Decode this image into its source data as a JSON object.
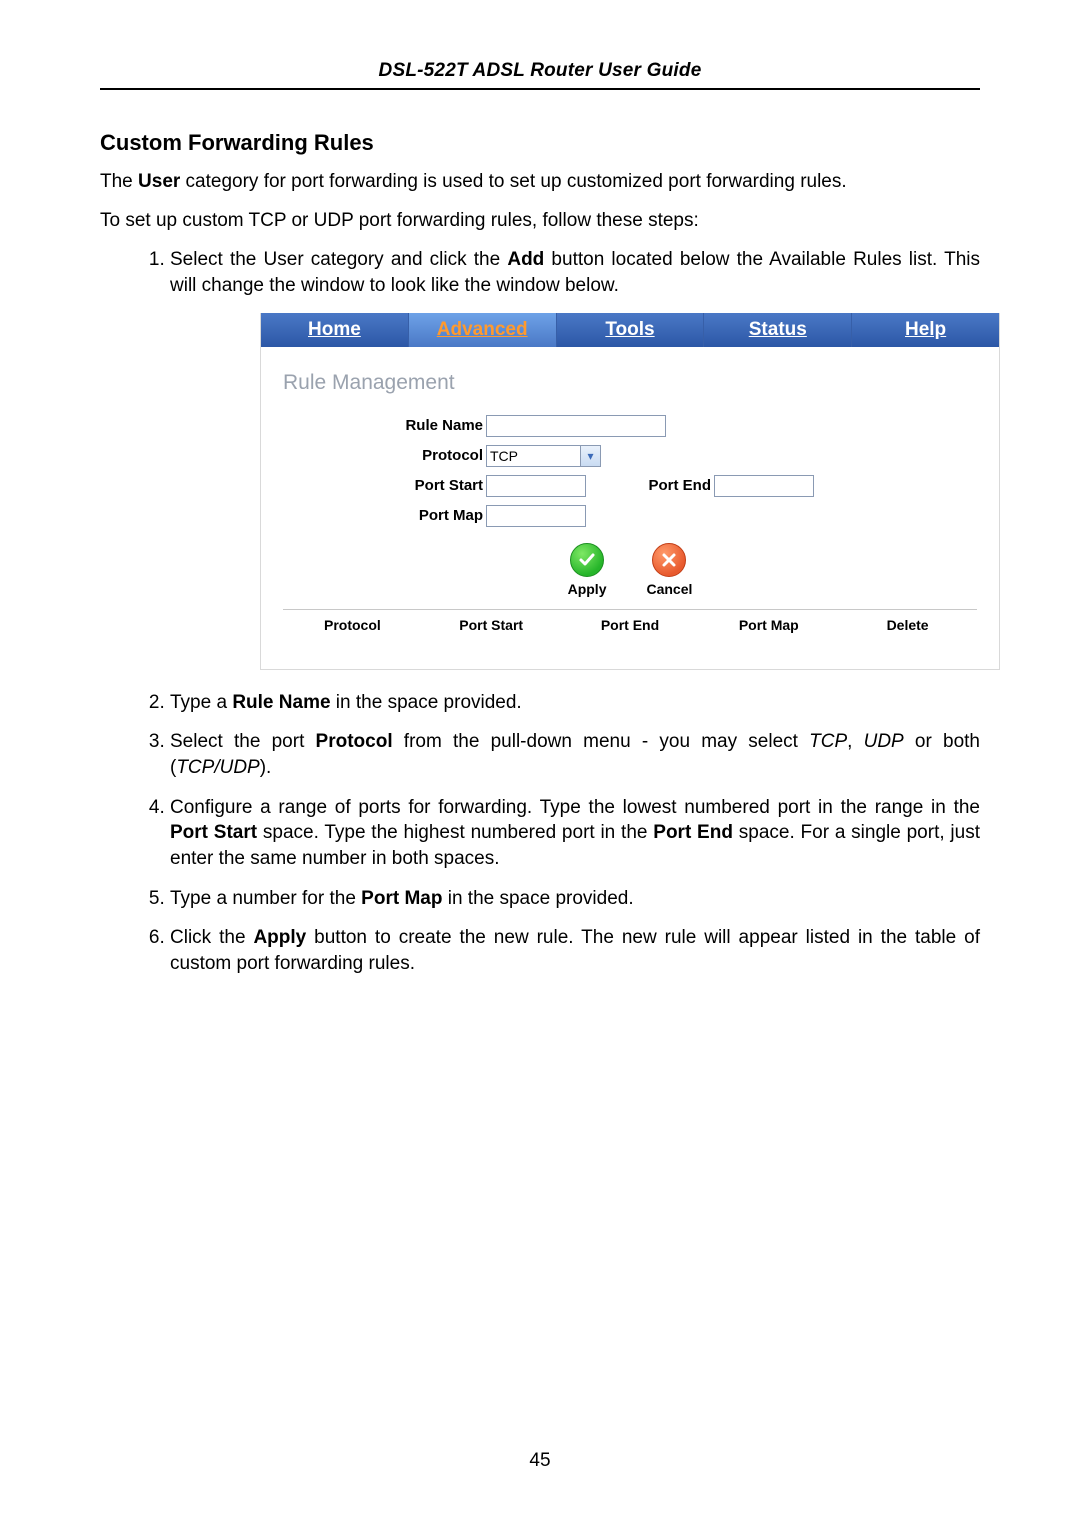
{
  "header": "DSL-522T ADSL Router User Guide",
  "page_number": "45",
  "section_title": "Custom Forwarding Rules",
  "intro1_pre": "The ",
  "intro1_b": "User",
  "intro1_post": " category for port forwarding is used to set up customized port forwarding rules.",
  "intro2": "To set up custom TCP or UDP port forwarding rules, follow these steps:",
  "step1_pre": "Select the User category and click the ",
  "step1_b": "Add",
  "step1_post": " button located below the Available Rules list. This will change the window to look like the window below.",
  "step2_pre": "Type a ",
  "step2_b": "Rule Name",
  "step2_post": " in the space provided.",
  "step3_a": "Select the port ",
  "step3_b": "Protocol",
  "step3_c": " from the pull-down menu - you may select ",
  "step3_i1": "TCP",
  "step3_d": ", ",
  "step3_i2": "UDP",
  "step3_e": " or both (",
  "step3_i3": "TCP/UDP",
  "step3_f": ").",
  "step4_a": "Configure a range of ports for forwarding. Type the lowest numbered port in the range in the ",
  "step4_b1": "Port Start",
  "step4_b": " space. Type the highest numbered port in the ",
  "step4_b2": "Port End",
  "step4_c": " space. For a single port, just enter the same number in both spaces.",
  "step5_a": "Type a number for the ",
  "step5_b": "Port Map",
  "step5_c": " in the space provided.",
  "step6_a": "Click the ",
  "step6_b": "Apply",
  "step6_c": " button to create the new rule. The new rule will appear listed in the table of custom port forwarding rules.",
  "ui": {
    "tabs": {
      "home": "Home",
      "advanced": "Advanced",
      "tools": "Tools",
      "status": "Status",
      "help": "Help"
    },
    "rm_title": "Rule Management",
    "labels": {
      "rule_name": "Rule Name",
      "protocol": "Protocol",
      "port_start": "Port Start",
      "port_end": "Port End",
      "port_map": "Port Map"
    },
    "protocol_value": "TCP",
    "apply": "Apply",
    "cancel": "Cancel",
    "table": {
      "protocol": "Protocol",
      "port_start": "Port Start",
      "port_end": "Port End",
      "port_map": "Port Map",
      "delete": "Delete"
    }
  }
}
